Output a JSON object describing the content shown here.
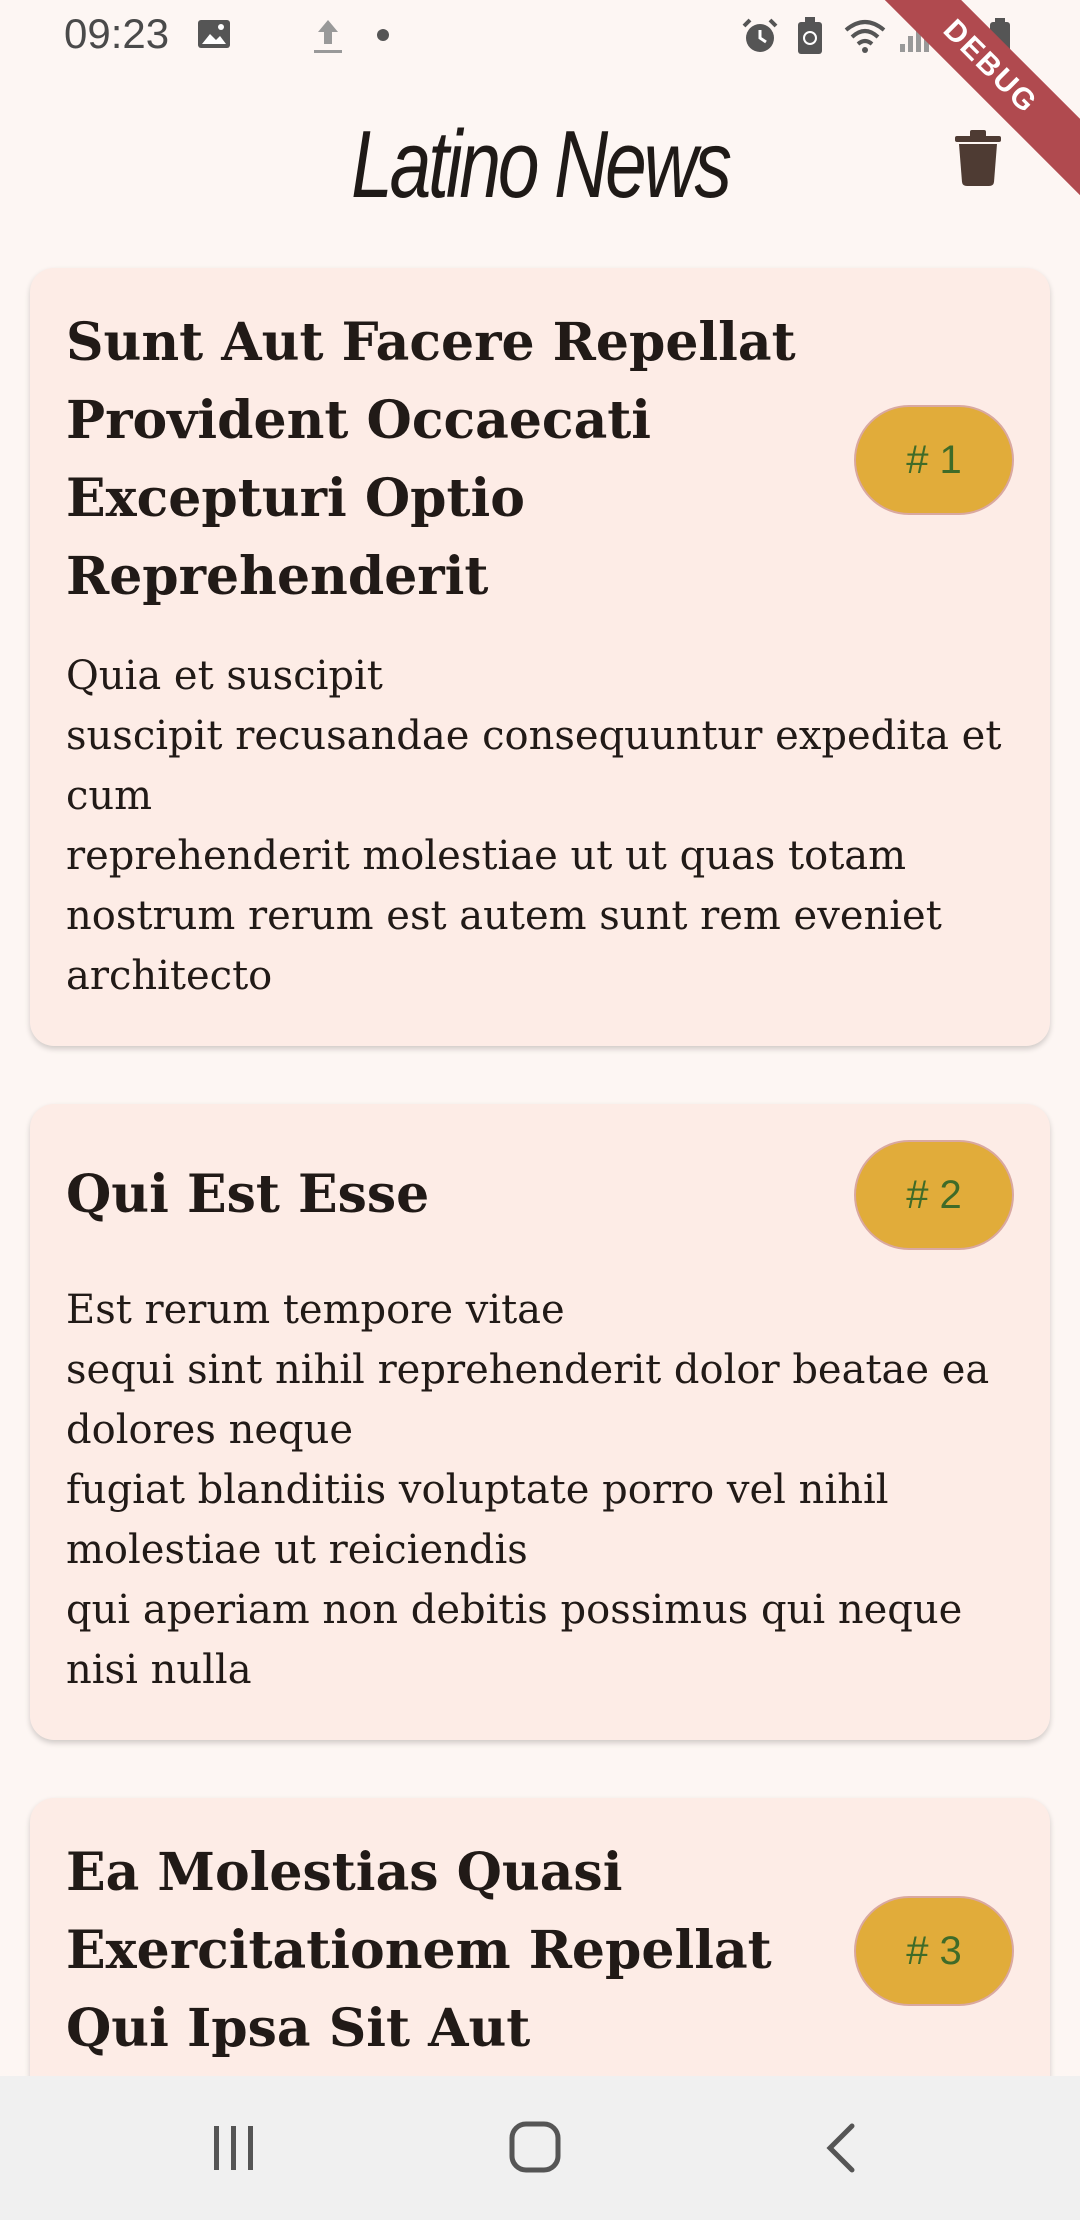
{
  "status_bar": {
    "time": "09:23",
    "left_icons": [
      "image-icon",
      "upload-icon",
      "dot-icon"
    ],
    "right_icons": [
      "alarm-icon",
      "battery-saver-icon",
      "wifi-icon",
      "signal-icon",
      "battery-icon"
    ]
  },
  "debug_banner": "DEBUG",
  "app_bar": {
    "title": "Latino News",
    "action_icon": "trash-icon"
  },
  "posts": [
    {
      "title": "Sunt Aut Facere Repellat Provident Occaecati Excepturi Optio Reprehenderit",
      "badge": "# 1",
      "body": "Quia et suscipit\nsuscipit recusandae consequuntur expedita et cum\nreprehenderit molestiae ut ut quas totam\nnostrum rerum est autem sunt rem eveniet architecto"
    },
    {
      "title": "Qui Est Esse",
      "badge": "# 2",
      "body": "Est rerum tempore vitae\nsequi sint nihil reprehenderit dolor beatae ea dolores neque\nfugiat blanditiis voluptate porro vel nihil molestiae ut reiciendis\nqui aperiam non debitis possimus qui neque nisi nulla"
    },
    {
      "title": "Ea Molestias Quasi Exercitationem Repellat Qui Ipsa Sit Aut",
      "badge": "# 3",
      "body": ""
    }
  ],
  "nav_bar": {
    "buttons": [
      "recent-apps-icon",
      "home-icon",
      "back-icon"
    ]
  },
  "colors": {
    "background": "#fdf6f3",
    "card": "#fdece6",
    "badge": "#e1ac3a",
    "badge_text": "#3f6b28",
    "debug_ribbon": "#b04a4f"
  }
}
